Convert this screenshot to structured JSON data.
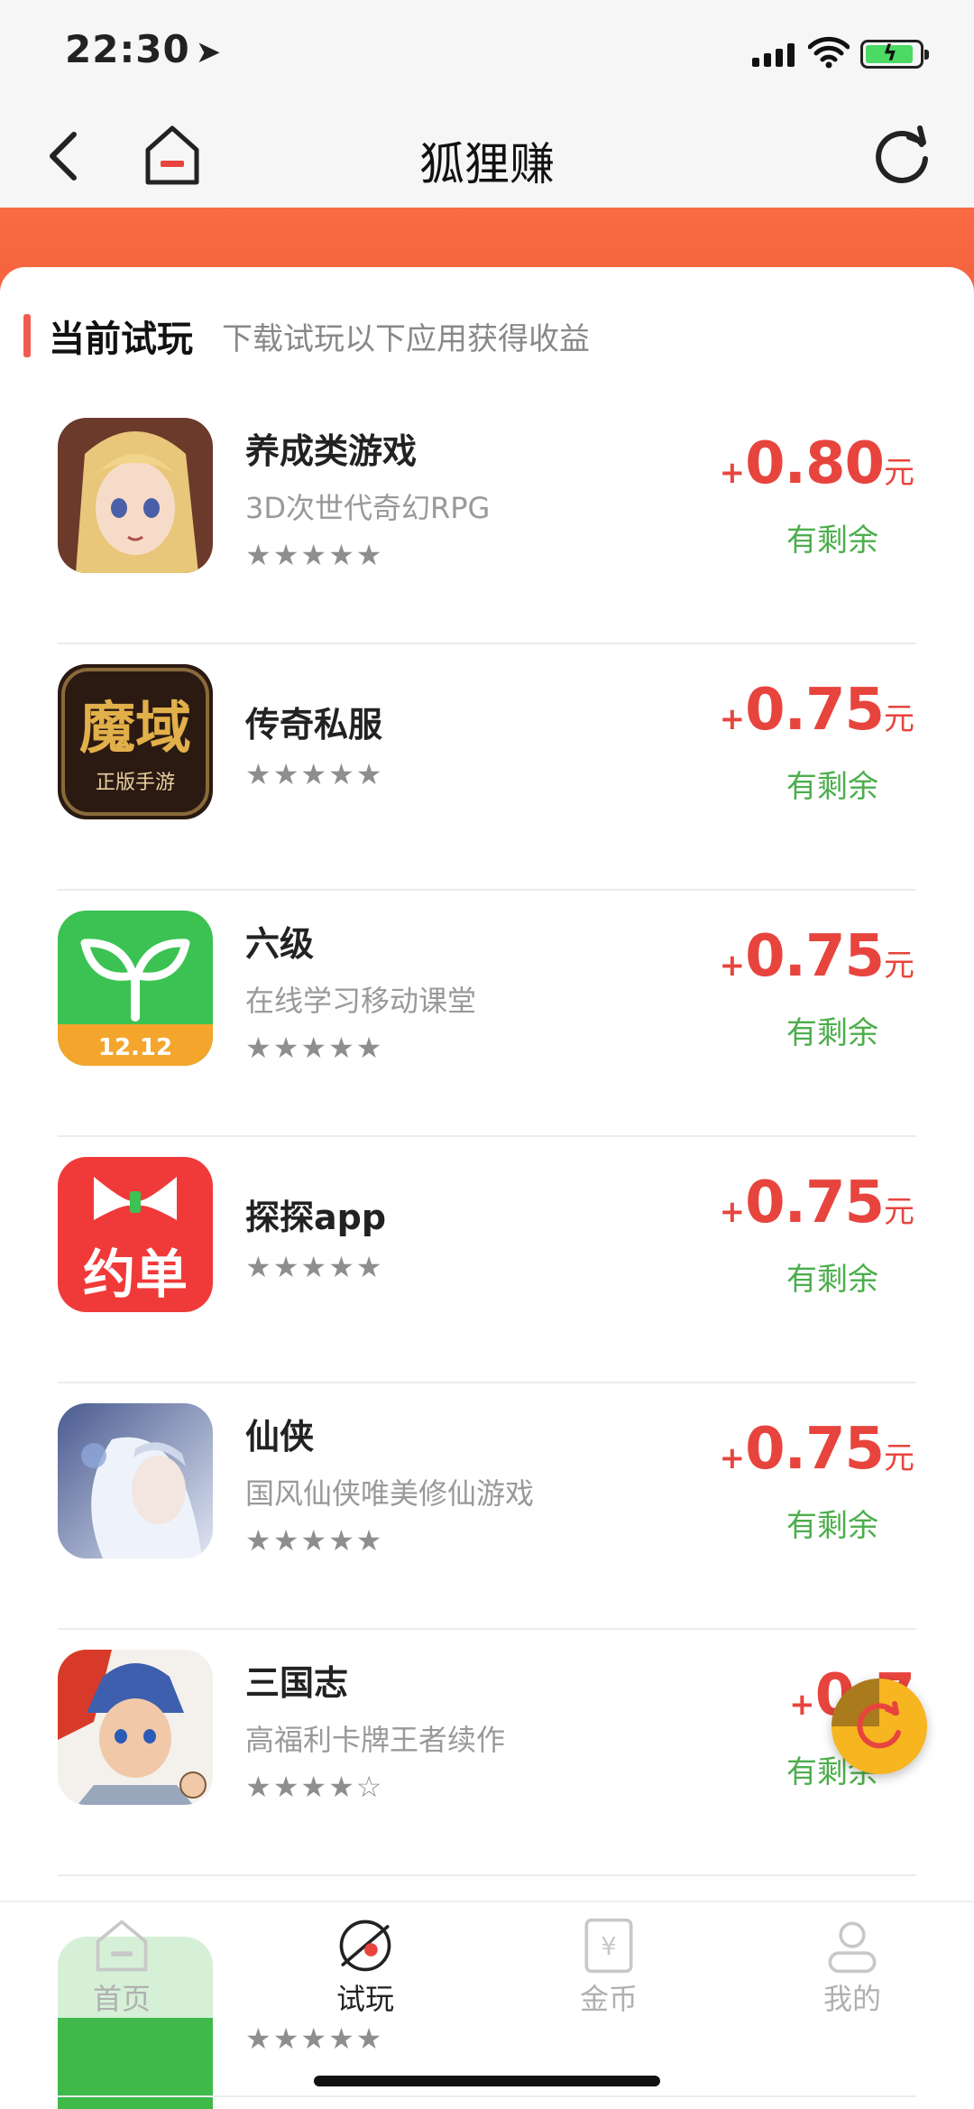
{
  "status_bar": {
    "time": "22:30",
    "location_icon": "location-arrow-icon",
    "battery_state": "charging"
  },
  "nav": {
    "title": "狐狸赚",
    "back_icon": "chevron-left-icon",
    "home_icon": "home-icon",
    "refresh_icon": "refresh-icon"
  },
  "section": {
    "title": "当前试玩",
    "subtitle": "下载试玩以下应用获得收益"
  },
  "apps": [
    {
      "name": "养成类游戏",
      "desc": "3D次世代奇幻RPG",
      "stars": "★★★★★",
      "rating": 5,
      "plus": "+",
      "amount": "0.80",
      "unit": "元",
      "status": "有剩余"
    },
    {
      "name": "传奇私服",
      "desc": "",
      "stars": "★★★★★",
      "rating": 5,
      "plus": "+",
      "amount": "0.75",
      "unit": "元",
      "status": "有剩余",
      "icon_text": "魔域",
      "icon_subtext": "正版手游"
    },
    {
      "name": "六级",
      "desc": "在线学习移动课堂",
      "stars": "★★★★★",
      "rating": 5,
      "plus": "+",
      "amount": "0.75",
      "unit": "元",
      "status": "有剩余",
      "icon_text": "12.12"
    },
    {
      "name": "探探app",
      "desc": "",
      "stars": "★★★★★",
      "rating": 5,
      "plus": "+",
      "amount": "0.75",
      "unit": "元",
      "status": "有剩余",
      "icon_text": "约单"
    },
    {
      "name": "仙侠",
      "desc": "国风仙侠唯美修仙游戏",
      "stars": "★★★★★",
      "rating": 5,
      "plus": "+",
      "amount": "0.75",
      "unit": "元",
      "status": "有剩余"
    },
    {
      "name": "三国志",
      "desc": "高福利卡牌王者续作",
      "stars": "★★★★☆",
      "rating": 4,
      "plus": "+",
      "amount": "0.7",
      "unit": "",
      "status": "有剩余"
    }
  ],
  "peek_row": {
    "stars": "★★★★★"
  },
  "tabs": [
    {
      "label": "首页",
      "icon": "home-icon",
      "active": false
    },
    {
      "label": "试玩",
      "icon": "trial-icon",
      "active": true
    },
    {
      "label": "金币",
      "icon": "coin-icon",
      "active": false
    },
    {
      "label": "我的",
      "icon": "user-icon",
      "active": false
    }
  ],
  "colors": {
    "accent_orange": "#f4613d",
    "reward_red": "#e8443e",
    "status_green": "#4cae4c",
    "float_button": "#f7b520"
  }
}
